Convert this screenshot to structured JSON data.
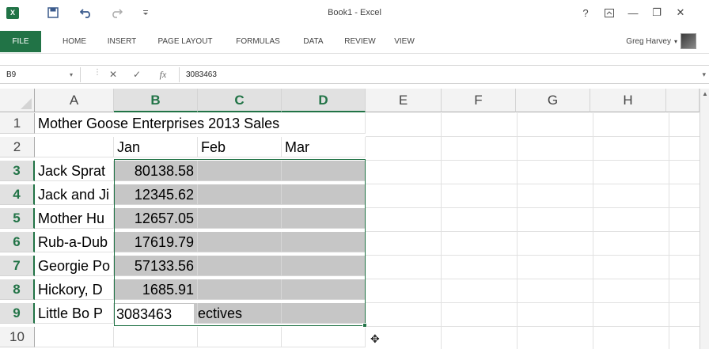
{
  "titlebar": {
    "app_icon_label": "X",
    "title": "Book1 - Excel",
    "help": "?",
    "ribbon_display": "⇡",
    "minimize": "—",
    "restore": "❐",
    "close": "✕"
  },
  "ribbon": {
    "tabs": [
      "FILE",
      "HOME",
      "INSERT",
      "PAGE LAYOUT",
      "FORMULAS",
      "DATA",
      "REVIEW",
      "VIEW"
    ],
    "user": "Greg Harvey",
    "user_caret": "▾"
  },
  "formula_bar": {
    "name_box": "B9",
    "cancel": "✕",
    "enter": "✓",
    "fx": "fx",
    "formula": "3083463"
  },
  "grid": {
    "columns": [
      "A",
      "B",
      "C",
      "D",
      "E",
      "F",
      "G",
      "H"
    ],
    "rows": [
      "1",
      "2",
      "3",
      "4",
      "5",
      "6",
      "7",
      "8",
      "9",
      "10"
    ],
    "selected_columns": [
      "B",
      "C",
      "D"
    ],
    "selected_rows": [
      "3",
      "4",
      "5",
      "6",
      "7",
      "8",
      "9"
    ],
    "cells": {
      "A1": "Mother Goose Enterprises 2013 Sales",
      "B2": "Jan",
      "C2": "Feb",
      "D2": "Mar",
      "A3": "Jack Sprat",
      "A4": "Jack and Ji",
      "A5": "Mother Hu",
      "A6": "Rub-a-Dub",
      "A7": "Georgie Po",
      "A8": "Hickory, D",
      "A9": "Little Bo P",
      "B3": "80138.58",
      "B4": "12345.62",
      "B5": "12657.05",
      "B6": "17619.79",
      "B7": "57133.56",
      "B8": "1685.91",
      "B9": "3083463",
      "B9_overflow": "ectives"
    }
  },
  "colors": {
    "accent": "#217346",
    "selection_fill": "#c6c6c6",
    "header_bg": "#f3f3f3"
  }
}
